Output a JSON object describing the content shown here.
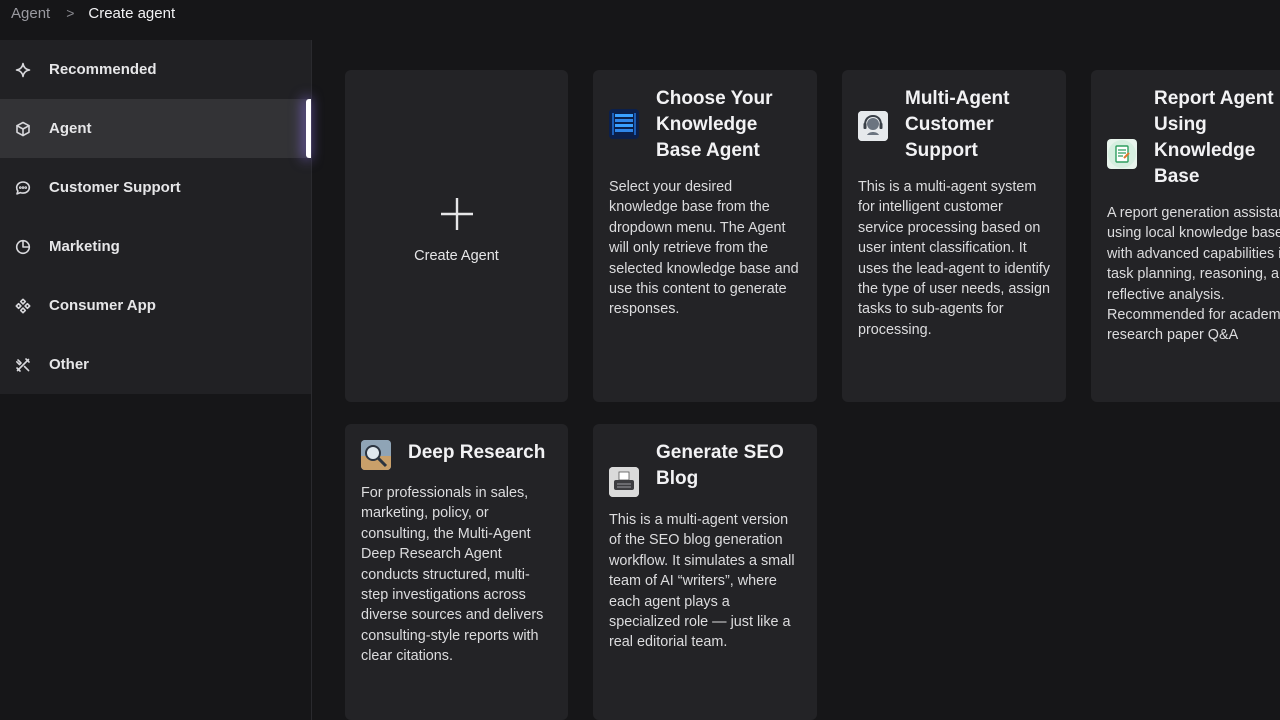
{
  "breadcrumb": {
    "root": "Agent",
    "separator": ">",
    "current": "Create agent"
  },
  "sidebar": {
    "items": [
      {
        "label": "Recommended",
        "icon": "sparkle-icon"
      },
      {
        "label": "Agent",
        "icon": "cube-icon",
        "active": true
      },
      {
        "label": "Customer Support",
        "icon": "chat-bubble-icon"
      },
      {
        "label": "Marketing",
        "icon": "pie-chart-icon"
      },
      {
        "label": "Consumer App",
        "icon": "components-icon"
      },
      {
        "label": "Other",
        "icon": "tools-icon"
      }
    ]
  },
  "create_card": {
    "label": "Create Agent",
    "icon": "plus-icon"
  },
  "cards": [
    {
      "title": "Choose Your Knowledge Base Agent",
      "description": "Select your desired knowledge base from the dropdown menu. The Agent will only retrieve from the selected knowledge base and use this content to generate responses.",
      "thumb": "knowledge-base-thumb"
    },
    {
      "title": "Multi-Agent Customer Support",
      "description": "This is a multi-agent system for intelligent customer service processing based on user intent classification. It uses the lead-agent to identify the type of user needs, assign tasks to sub-agents for processing.",
      "thumb": "headset-thumb"
    },
    {
      "title": "Report Agent Using Knowledge Base",
      "description": "A report generation assistant using local knowledge base, with advanced capabilities in task planning, reasoning, and reflective analysis. Recommended for academic research paper Q&A",
      "thumb": "report-thumb"
    },
    {
      "title": "Deep Research",
      "description": "For professionals in sales, marketing, policy, or consulting, the Multi-Agent Deep Research Agent conducts structured, multi-step investigations across diverse sources and delivers consulting-style reports with clear citations.",
      "thumb": "research-thumb"
    },
    {
      "title": "Generate SEO Blog",
      "description": "This is a multi-agent version of the SEO blog generation workflow. It simulates a small team of AI “writers”, where each agent plays a specialized role — just like a real editorial team.",
      "thumb": "typewriter-thumb"
    }
  ]
}
